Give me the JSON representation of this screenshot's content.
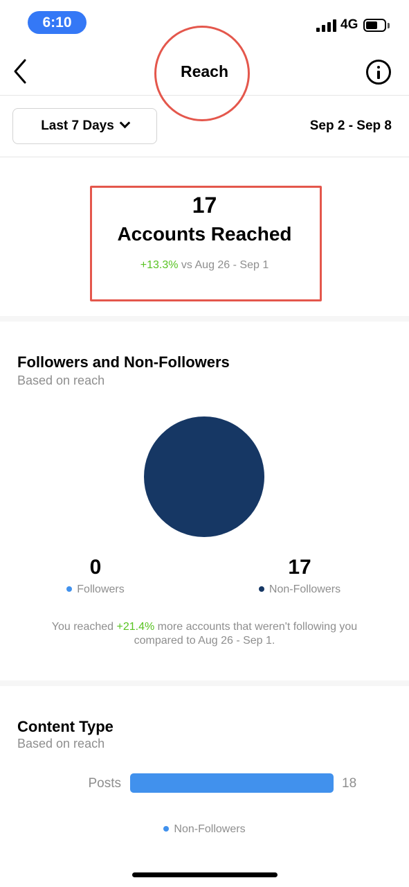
{
  "status_bar": {
    "time": "6:10",
    "network": "4G",
    "battery_level": 0.65
  },
  "nav": {
    "title": "Reach"
  },
  "filter": {
    "range_label": "Last 7 Days",
    "date_range": "Sep 2 - Sep 8"
  },
  "reach": {
    "count": "17",
    "label": "Accounts Reached",
    "change": "+13.3%",
    "comparison": " vs Aug 26 - Sep 1"
  },
  "followers": {
    "title": "Followers and Non-Followers",
    "subtitle": "Based on reach",
    "followers_value": "0",
    "followers_label": "Followers",
    "non_followers_value": "17",
    "non_followers_label": "Non-Followers",
    "note_prefix": "You reached ",
    "note_change": "+21.4%",
    "note_suffix": " more accounts that weren't following you compared to Aug 26 - Sep 1.",
    "colors": {
      "followers": "#4191ed",
      "non_followers": "#163764"
    }
  },
  "content_type": {
    "title": "Content Type",
    "subtitle": "Based on reach",
    "legend": "Non-Followers",
    "bar_color": "#4191ed"
  },
  "chart_data": [
    {
      "type": "pie",
      "categories": [
        "Followers",
        "Non-Followers"
      ],
      "values": [
        0,
        17
      ],
      "colors": [
        "#4191ed",
        "#163764"
      ]
    },
    {
      "type": "bar",
      "orientation": "horizontal",
      "categories": [
        "Posts"
      ],
      "series": [
        {
          "name": "Non-Followers",
          "values": [
            18
          ]
        }
      ],
      "xlim": [
        0,
        18
      ]
    }
  ]
}
